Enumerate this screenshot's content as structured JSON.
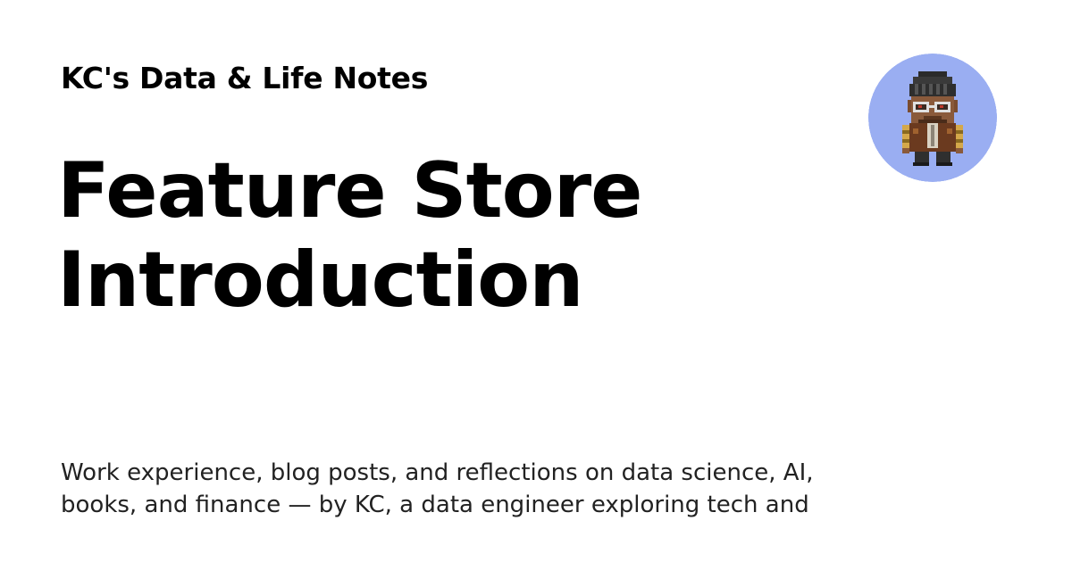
{
  "site": {
    "name": "KC's Data & Life Notes"
  },
  "post": {
    "title_lines": [
      "Feature Store",
      "Introduction"
    ]
  },
  "description": {
    "lines": [
      "Work experience, blog posts, and reflections on data science, AI,",
      "books, and finance — by KC, a data engineer exploring tech and"
    ]
  },
  "avatar": {
    "icon": "pixel-art-person-icon",
    "background_color": "#9AAEF2"
  },
  "colors": {
    "background": "#FFFFFF",
    "text": "#000000"
  }
}
